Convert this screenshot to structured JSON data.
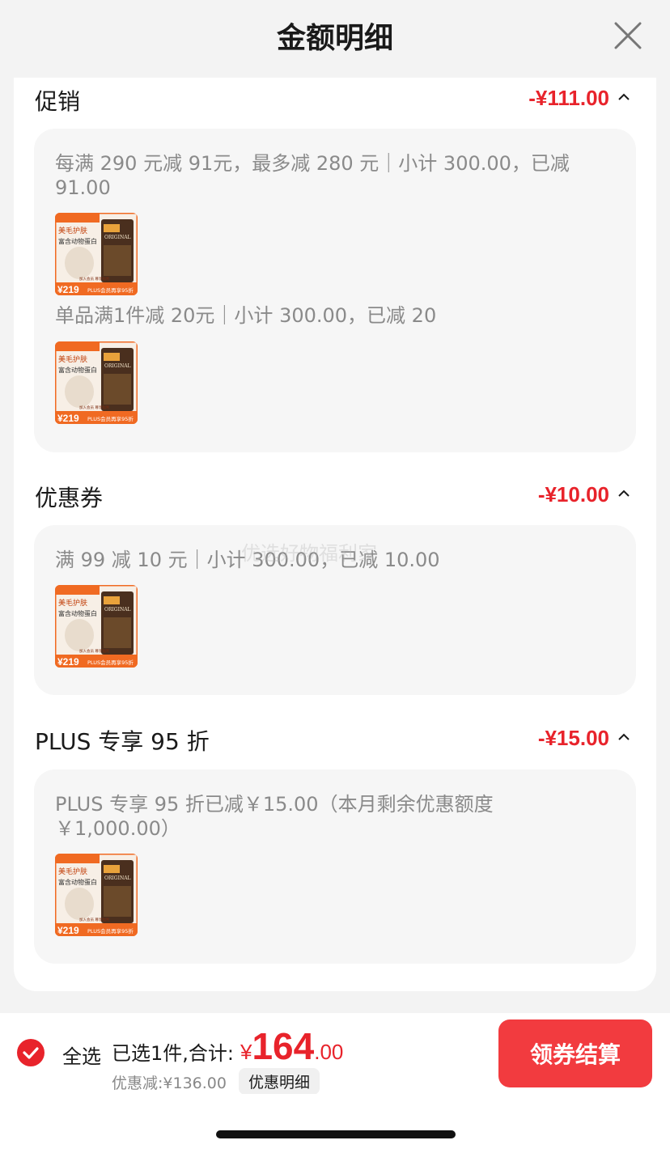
{
  "header": {
    "title": "金额明细",
    "close_icon": "close-icon"
  },
  "sections": [
    {
      "title": "促销",
      "amount": "-¥111.00",
      "expanded": true,
      "rules": [
        {
          "text": "每满 290 元减 91元，最多减 280 元｜小计 300.00，已减 91.00"
        },
        {
          "text": "单品满1件减 20元｜小计 300.00，已减 20"
        }
      ]
    },
    {
      "title": "优惠券",
      "amount": "-¥10.00",
      "expanded": true,
      "rules": [
        {
          "text": "满 99 减 10 元｜小计 300.00，已减 10.00"
        }
      ]
    },
    {
      "title": "PLUS 专享 95 折",
      "amount": "-¥15.00",
      "expanded": true,
      "rules": [
        {
          "text": "PLUS 专享 95 折已减￥15.00（本月剩余优惠额度 ￥1,000.00）"
        }
      ]
    }
  ],
  "product_thumb": {
    "brand": "ORIGINAL",
    "line1": "美毛护肤",
    "line2": "富含动物蛋白",
    "price": "219",
    "price_prefix": "¥",
    "badge": "PLUS会员再享95折",
    "note": "加入会员 尊享福利"
  },
  "watermark": "优选好物福利家",
  "bottom_bar": {
    "select_all": "全选",
    "selected_info": "已选1件,合计:",
    "total_symbol": "¥",
    "total_int": "164",
    "total_dec": ".00",
    "discount": "优惠减:¥136.00",
    "detail_button": "优惠明细",
    "checkout_button": "领券结算"
  },
  "colors": {
    "accent": "#e8232b",
    "button": "#f23b3f",
    "card_bg": "#f6f6f6",
    "page_bg": "#f3f3f3"
  }
}
